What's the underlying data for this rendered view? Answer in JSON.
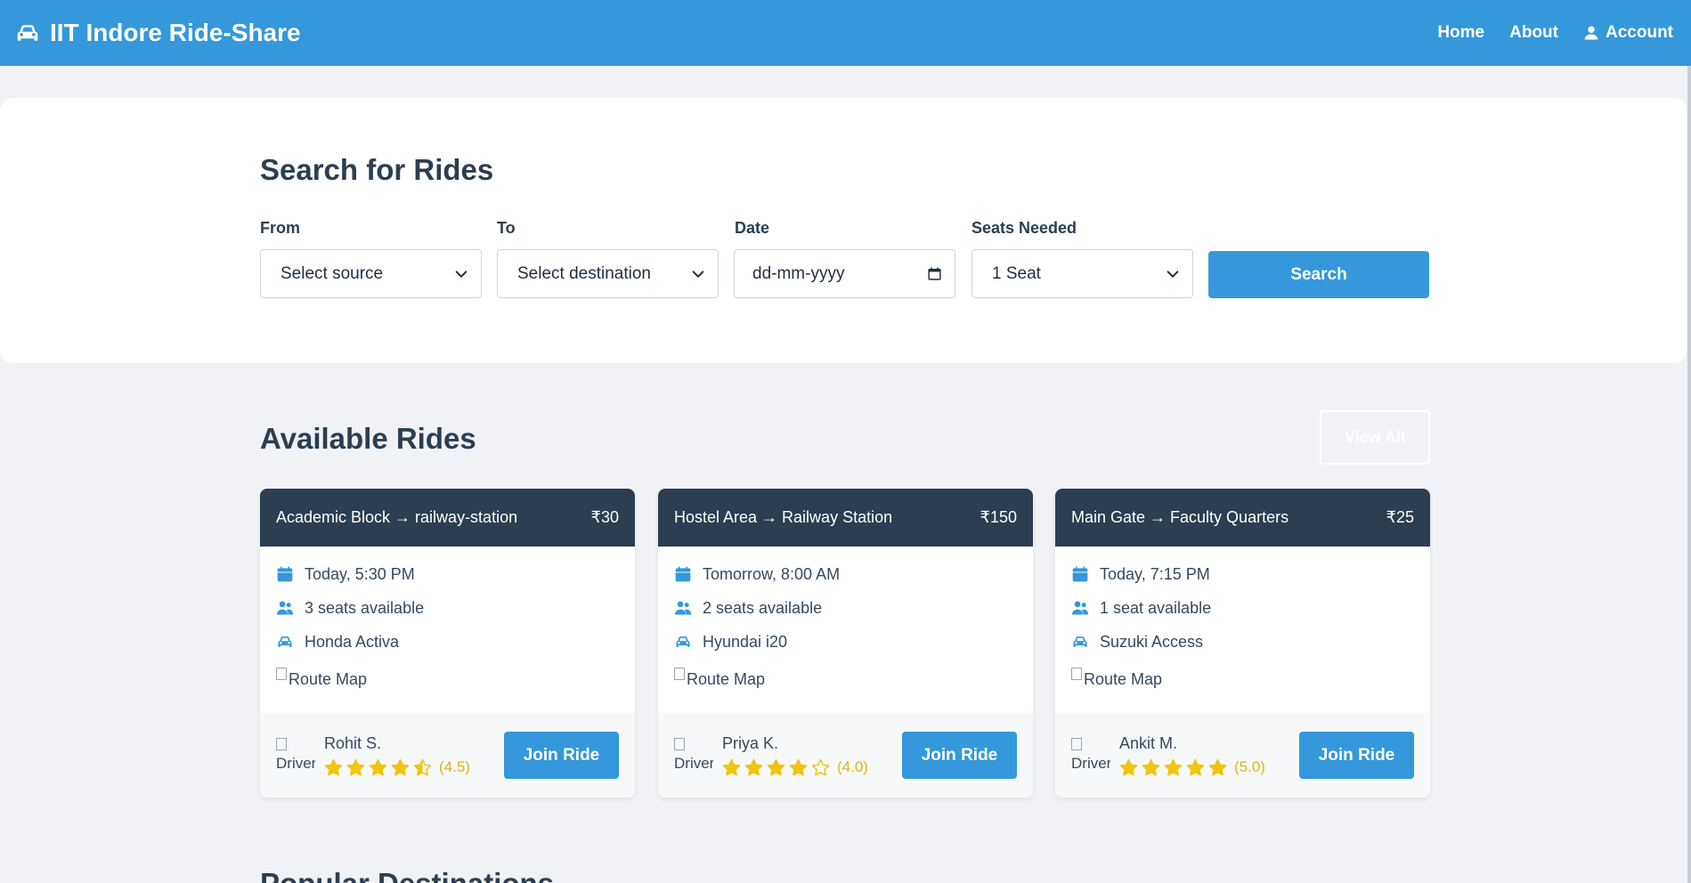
{
  "navbar": {
    "brand": "IIT Indore Ride-Share",
    "brand_icon": "car-icon",
    "links": [
      "Home",
      "About",
      "Account"
    ],
    "account_icon": "user-icon"
  },
  "search": {
    "title": "Search for Rides",
    "from_label": "From",
    "from_value": "Select source",
    "to_label": "To",
    "to_value": "Select destination",
    "date_label": "Date",
    "date_value": "dd-mm-yyyy",
    "seats_label": "Seats Needed",
    "seats_value": "1 Seat",
    "button": "Search"
  },
  "available": {
    "title": "Available Rides",
    "view_all": "View All",
    "rides": [
      {
        "route": "Academic Block → railway-station",
        "price": "₹30",
        "time": "Today, 5:30 PM",
        "seats": "3 seats available",
        "vehicle": "Honda Activa",
        "map_alt": "Route Map",
        "driver_alt": "Driver",
        "driver": "Rohit S.",
        "stars": 4.5,
        "rating": "(4.5)",
        "button": "Join Ride"
      },
      {
        "route": "Hostel Area → Railway Station",
        "price": "₹150",
        "time": "Tomorrow, 8:00 AM",
        "seats": "2 seats available",
        "vehicle": "Hyundai i20",
        "map_alt": "Route Map",
        "driver_alt": "Driver",
        "driver": "Priya K.",
        "stars": 4.0,
        "rating": "(4.0)",
        "button": "Join Ride"
      },
      {
        "route": "Main Gate → Faculty Quarters",
        "price": "₹25",
        "time": "Today, 7:15 PM",
        "seats": "1 seat available",
        "vehicle": "Suzuki Access",
        "map_alt": "Route Map",
        "driver_alt": "Driver",
        "driver": "Ankit M.",
        "stars": 5.0,
        "rating": "(5.0)",
        "button": "Join Ride"
      }
    ]
  },
  "popular": {
    "title": "Popular Destinations"
  },
  "colors": {
    "primary": "#3498db",
    "dark": "#2c3e50",
    "star": "#f1c40f"
  }
}
